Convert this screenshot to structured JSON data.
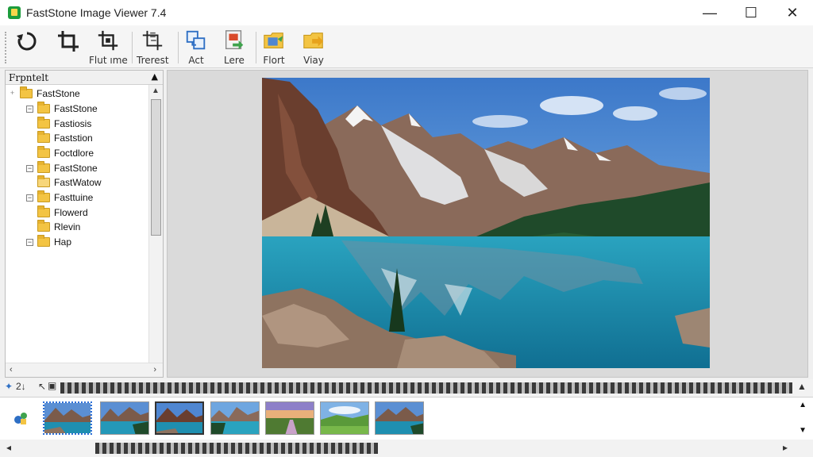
{
  "window": {
    "title": "FastStone Image Viewer 7.4",
    "controls": {
      "minimize": "—",
      "maximize": "☐",
      "close": "✕"
    }
  },
  "toolbar": {
    "buttons": [
      {
        "label": "",
        "icon": "rotate-icon"
      },
      {
        "label": "",
        "icon": "crop-icon"
      },
      {
        "label": "Flut ıme",
        "icon": "crop-alt-icon"
      },
      {
        "label": "Trerest",
        "icon": "resize-icon"
      },
      {
        "label": "Act",
        "icon": "copy-icon"
      },
      {
        "label": "Lere",
        "icon": "export-icon"
      },
      {
        "label": "Flort",
        "icon": "folder-star-icon"
      },
      {
        "label": "Viay",
        "icon": "folder-arrow-icon"
      }
    ]
  },
  "folder_panel": {
    "header": "Frpntelt",
    "tree": [
      {
        "label": "FastStone",
        "toggle": "+",
        "level": 0
      },
      {
        "label": "FastStone",
        "toggle": "−",
        "level": 1
      },
      {
        "label": "Fastiosis",
        "toggle": "",
        "level": 1
      },
      {
        "label": "Faststion",
        "toggle": "",
        "level": 1
      },
      {
        "label": "Foctdlore",
        "toggle": "",
        "level": 1
      },
      {
        "label": "FastStone",
        "toggle": "−",
        "level": 1
      },
      {
        "label": "FastWatow",
        "toggle": "",
        "level": 1
      },
      {
        "label": "Fasttuine",
        "toggle": "−",
        "level": 1
      },
      {
        "label": "Flowerd",
        "toggle": "",
        "level": 1
      },
      {
        "label": "Rlevin",
        "toggle": "",
        "level": 1
      },
      {
        "label": "Hap",
        "toggle": "−",
        "level": 1
      }
    ]
  },
  "filmstrip": {
    "left_label": "2↓",
    "thumbnails": [
      {
        "scene": "mountain-lake"
      },
      {
        "scene": "mountain-lake"
      },
      {
        "scene": "mountain-lake"
      },
      {
        "scene": "mountain-lake"
      },
      {
        "scene": "sunset-field"
      },
      {
        "scene": "green-meadow"
      },
      {
        "scene": "mountain-lake"
      }
    ]
  },
  "colors": {
    "sky": "#4f86d1",
    "lake": "#1f8fb0",
    "forest": "#1f4a2a",
    "folder": "#f3c443"
  }
}
